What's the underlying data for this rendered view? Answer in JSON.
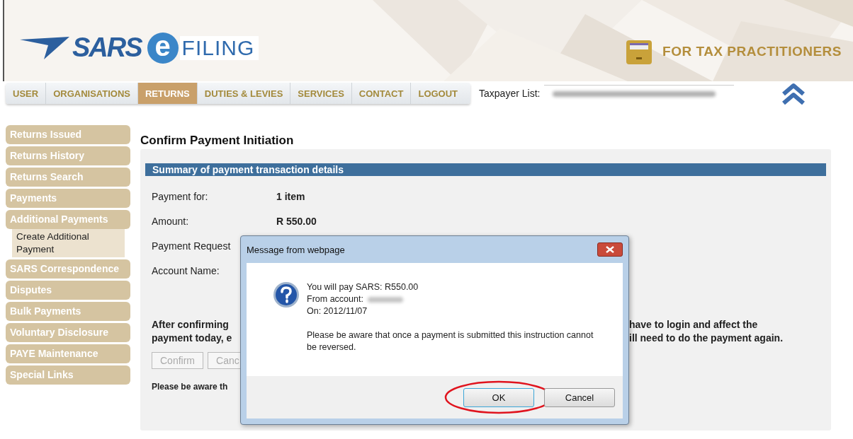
{
  "header": {
    "logo": {
      "sars": "SARS",
      "e": "e",
      "filing": "FILING"
    },
    "practitioners": "FOR TAX PRACTITIONERS"
  },
  "nav": {
    "tabs": [
      {
        "label": "USER",
        "selected": false
      },
      {
        "label": "ORGANISATIONS",
        "selected": false
      },
      {
        "label": "RETURNS",
        "selected": true
      },
      {
        "label": "DUTIES & LEVIES",
        "selected": false
      },
      {
        "label": "SERVICES",
        "selected": false
      },
      {
        "label": "CONTACT",
        "selected": false
      },
      {
        "label": "LOGOUT",
        "selected": false
      }
    ],
    "taxpayer_label": "Taxpayer List:",
    "taxpayer_value_redacted": true
  },
  "sidebar": {
    "items": [
      {
        "label": "Returns Issued"
      },
      {
        "label": "Returns History"
      },
      {
        "label": "Returns Search"
      },
      {
        "label": "Payments"
      },
      {
        "label": "Additional Payments",
        "children": [
          {
            "label": "Create Additional Payment"
          }
        ]
      },
      {
        "label": "SARS Correspondence"
      },
      {
        "label": "Disputes"
      },
      {
        "label": "Bulk Payments"
      },
      {
        "label": "Voluntary Disclosure"
      },
      {
        "label": "PAYE Maintenance"
      },
      {
        "label": "Special Links"
      }
    ]
  },
  "main": {
    "title": "Confirm Payment Initiation",
    "section_title": "Summary of payment transaction details",
    "fields": [
      {
        "label": "Payment for:",
        "value": "1 item"
      },
      {
        "label": "Amount:",
        "value": "R 550.00"
      },
      {
        "label": "Payment Request"
      },
      {
        "label": "Account Name:"
      }
    ],
    "notice_left": [
      "After confirming",
      "payment today, e"
    ],
    "notice_right": [
      "have to login and affect the",
      "ill need to do the payment again."
    ],
    "buttons": [
      {
        "label": "Confirm"
      },
      {
        "label": "Canc"
      }
    ],
    "footer_note": "Please be aware th"
  },
  "dialog": {
    "title": "Message from webpage",
    "lines": [
      {
        "text": "You will pay SARS: R550.00"
      },
      {
        "text": "From account:",
        "redacted": true
      },
      {
        "text": "On: 2012/11/07"
      }
    ],
    "note": "Please be aware that once a payment is submitted this instruction cannot be reversed.",
    "buttons": [
      {
        "label": "OK",
        "focused": true,
        "circled": true
      },
      {
        "label": "Cancel",
        "focused": false,
        "circled": false
      }
    ]
  }
}
